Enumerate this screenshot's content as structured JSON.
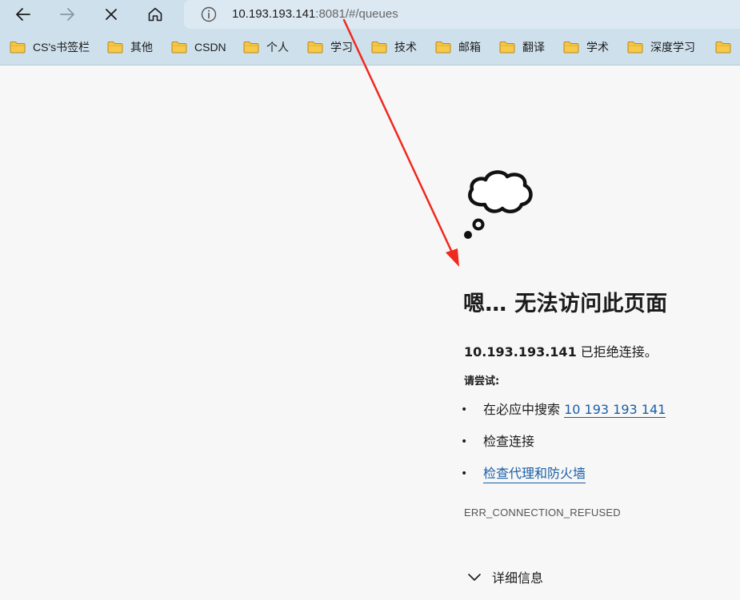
{
  "browser": {
    "nav": {
      "back_icon": "arrow-left-icon",
      "forward_icon": "arrow-right-icon",
      "stop_icon": "close-icon",
      "home_icon": "home-icon"
    },
    "address": {
      "info_icon": "info-icon",
      "host": "10.193.193.141",
      "path": ":8081/#/queues"
    },
    "bookmarks": [
      {
        "label": "CS's书签栏"
      },
      {
        "label": "其他"
      },
      {
        "label": "CSDN"
      },
      {
        "label": "个人"
      },
      {
        "label": "学习"
      },
      {
        "label": "技术"
      },
      {
        "label": "邮箱"
      },
      {
        "label": "翻译"
      },
      {
        "label": "学术"
      },
      {
        "label": "深度学习"
      },
      {
        "label": ""
      }
    ]
  },
  "error_page": {
    "icon": "thought-cloud-icon",
    "title": "嗯… 无法访问此页面",
    "host": "10.193.193.141",
    "message": " 已拒绝连接。",
    "try_label": "请尝试:",
    "suggestions": {
      "search_prefix": "在必应中搜索 ",
      "search_link": "10 193 193 141",
      "check_connection": "检查连接",
      "check_proxy": "检查代理和防火墙"
    },
    "bullet": "•",
    "error_code": "ERR_CONNECTION_REFUSED",
    "details_label": "详细信息"
  },
  "colors": {
    "annotation_arrow": "#f0281e",
    "link": "#1a5fa6",
    "folder": "#f7c948"
  }
}
